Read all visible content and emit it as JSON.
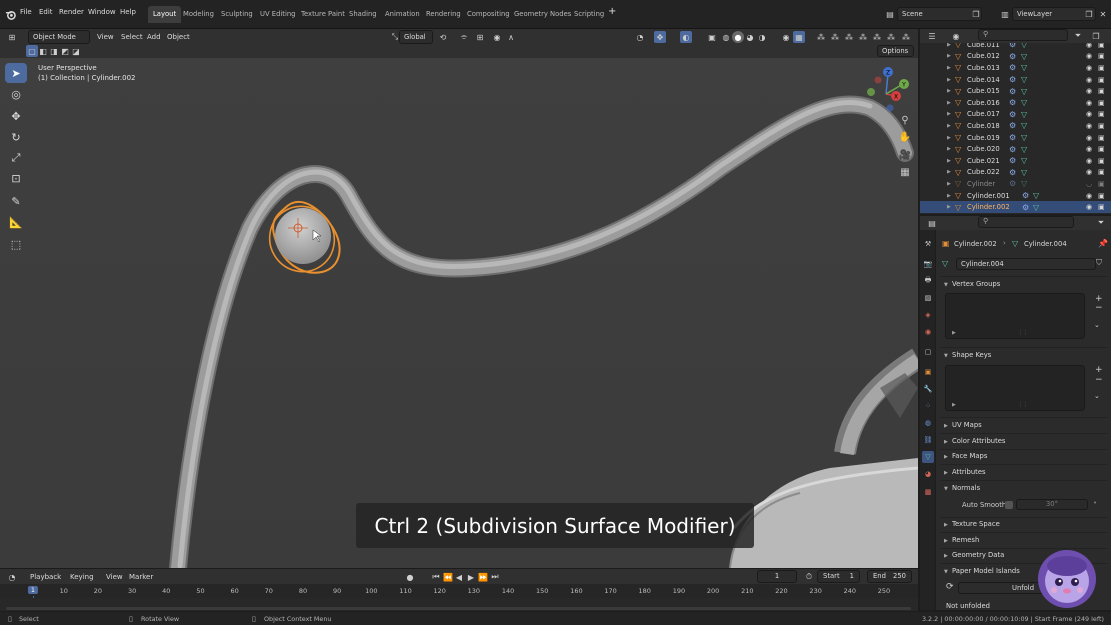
{
  "menu": [
    "File",
    "Edit",
    "Render",
    "Window",
    "Help"
  ],
  "workspaces": [
    "Layout",
    "Modeling",
    "Sculpting",
    "UV Editing",
    "Texture Paint",
    "Shading",
    "Animation",
    "Rendering",
    "Compositing",
    "Geometry Nodes",
    "Scripting"
  ],
  "active_workspace": "Layout",
  "scene": "Scene",
  "view_layer": "ViewLayer",
  "viewport": {
    "mode": "Object Mode",
    "menus": [
      "View",
      "Select",
      "Add",
      "Object"
    ],
    "transform": "Global",
    "options": "Options",
    "overlay_line1": "User Perspective",
    "overlay_line2": "(1) Collection | Cylinder.002",
    "axes": {
      "x": "X",
      "y": "Y",
      "z": "Z"
    },
    "caption": "Ctrl 2 (Subdivision Surface Modifier)"
  },
  "outliner": {
    "rows": [
      {
        "name": "Cube.011",
        "selected": false
      },
      {
        "name": "Cube.012",
        "selected": false
      },
      {
        "name": "Cube.013",
        "selected": false
      },
      {
        "name": "Cube.014",
        "selected": false
      },
      {
        "name": "Cube.015",
        "selected": false
      },
      {
        "name": "Cube.016",
        "selected": false
      },
      {
        "name": "Cube.017",
        "selected": false
      },
      {
        "name": "Cube.018",
        "selected": false
      },
      {
        "name": "Cube.019",
        "selected": false
      },
      {
        "name": "Cube.020",
        "selected": false
      },
      {
        "name": "Cube.021",
        "selected": false
      },
      {
        "name": "Cube.022",
        "selected": false
      },
      {
        "name": "Cylinder",
        "selected": false
      },
      {
        "name": "Cylinder.001",
        "selected": false
      },
      {
        "name": "Cylinder.002",
        "selected": true
      }
    ]
  },
  "properties": {
    "object": "Cylinder.002",
    "mesh": "Cylinder.004",
    "mesh_field": "Cylinder.004",
    "panels": {
      "vertex_groups": "Vertex Groups",
      "shape_keys": "Shape Keys",
      "uv_maps": "UV Maps",
      "color_attributes": "Color Attributes",
      "face_maps": "Face Maps",
      "attributes": "Attributes",
      "normals": "Normals",
      "auto_smooth": "Auto Smooth",
      "auto_smooth_angle": "30°",
      "texture_space": "Texture Space",
      "remesh": "Remesh",
      "geometry_data": "Geometry Data",
      "paper_model": "Paper Model Islands",
      "unfold": "Unfold",
      "not_unfolded": "Not unfolded"
    }
  },
  "timeline": {
    "menus": [
      "Playback",
      "Keying",
      "View",
      "Marker"
    ],
    "current_frame": "1",
    "start_label": "Start",
    "start": "1",
    "end_label": "End",
    "end": "250",
    "ticks": [
      1,
      10,
      20,
      30,
      40,
      50,
      60,
      70,
      80,
      90,
      100,
      110,
      120,
      130,
      140,
      150,
      160,
      170,
      180,
      190,
      200,
      210,
      220,
      230,
      240,
      250
    ]
  },
  "status": {
    "select": "Select",
    "rotate": "Rotate View",
    "context": "Object Context Menu",
    "info": "3.2.2 | 00:00:00:00 / 00:00:10:09 | Start Frame (249 left)"
  },
  "colors": {
    "accent": "#4d6b9e",
    "selection": "#e8902f",
    "viewport_bg": "#3d3d3d"
  }
}
